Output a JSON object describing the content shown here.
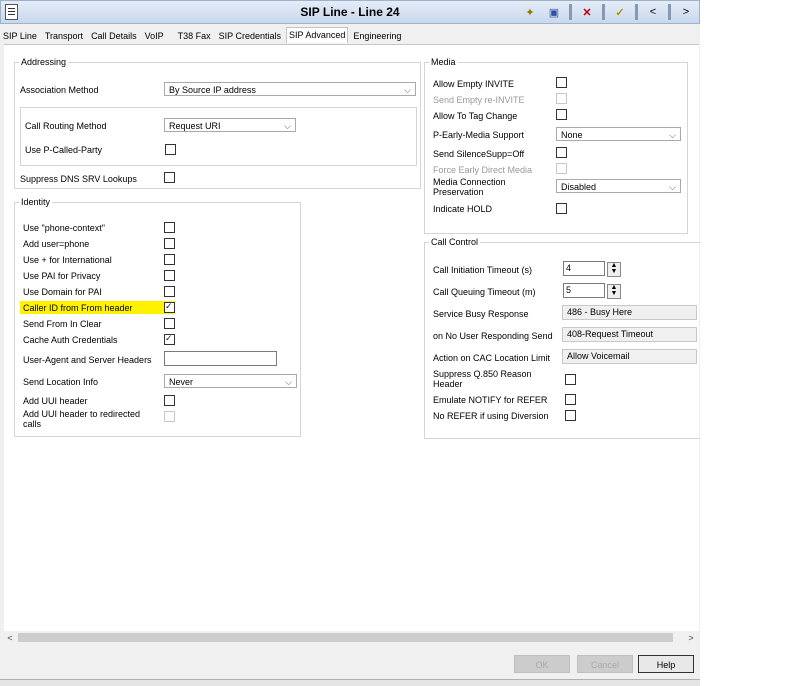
{
  "window": {
    "title": "SIP Line - Line 24",
    "toolbar_icons": [
      "new-icon",
      "save-icon",
      "delete-icon",
      "validate-icon",
      "previous-icon",
      "next-icon"
    ]
  },
  "tabs": [
    {
      "label": "SIP Line",
      "active": false
    },
    {
      "label": "Transport",
      "active": false
    },
    {
      "label": "Call Details",
      "active": false
    },
    {
      "label": "VoIP",
      "active": false
    },
    {
      "label": "T38 Fax",
      "active": false
    },
    {
      "label": "SIP Credentials",
      "active": false
    },
    {
      "label": "SIP Advanced",
      "active": true
    },
    {
      "label": "Engineering",
      "active": false
    }
  ],
  "addressing": {
    "legend": "Addressing",
    "association_method": {
      "label": "Association Method",
      "value": "By Source IP address"
    },
    "call_routing_method": {
      "label": "Call Routing Method",
      "value": "Request URI"
    },
    "use_p_called_party": {
      "label": "Use P-Called-Party",
      "checked": false
    },
    "suppress_dns_srv": {
      "label": "Suppress DNS SRV Lookups",
      "checked": false
    }
  },
  "identity": {
    "legend": "Identity",
    "items": [
      {
        "label": "Use \"phone-context\"",
        "checked": false
      },
      {
        "label": "Add user=phone",
        "checked": false
      },
      {
        "label": "Use + for International",
        "checked": false
      },
      {
        "label": "Use PAI for Privacy",
        "checked": false
      },
      {
        "label": "Use Domain for PAI",
        "checked": false
      },
      {
        "label": "Caller ID from From header",
        "checked": true,
        "highlight": true
      },
      {
        "label": "Send From In Clear",
        "checked": false
      },
      {
        "label": "Cache Auth Credentials",
        "checked": true
      }
    ],
    "user_agent": {
      "label": "User-Agent and Server Headers",
      "value": ""
    },
    "send_location_info": {
      "label": "Send Location Info",
      "value": "Never"
    },
    "add_uui_header": {
      "label": "Add UUI header",
      "checked": false
    },
    "add_uui_redirected": {
      "label": "Add UUI header to redirected calls",
      "checked": false,
      "disabled": true
    }
  },
  "media": {
    "legend": "Media",
    "allow_empty_invite": {
      "label": "Allow Empty INVITE",
      "checked": false
    },
    "send_empty_reinvite": {
      "label": "Send Empty re-INVITE",
      "checked": false,
      "disabled": true
    },
    "allow_to_tag_change": {
      "label": "Allow To Tag Change",
      "checked": false
    },
    "p_early_media": {
      "label": "P-Early-Media Support",
      "value": "None"
    },
    "send_silence_supp": {
      "label": "Send SilenceSupp=Off",
      "checked": false
    },
    "force_early_direct": {
      "label": "Force Early Direct Media",
      "checked": false,
      "disabled": true
    },
    "media_conn_preservation": {
      "label": "Media Connection Preservation",
      "value": "Disabled"
    },
    "indicate_hold": {
      "label": "Indicate HOLD",
      "checked": false
    }
  },
  "call_control": {
    "legend": "Call Control",
    "call_initiation_timeout": {
      "label": "Call Initiation Timeout (s)",
      "value": "4"
    },
    "call_queuing_timeout": {
      "label": "Call Queuing Timeout (m)",
      "value": "5"
    },
    "service_busy_response": {
      "label": "Service Busy Response",
      "value": "486 - Busy Here"
    },
    "no_user_responding": {
      "label": "on No User Responding Send",
      "value": "408-Request Timeout"
    },
    "cac_location_limit": {
      "label": "Action on CAC Location Limit",
      "value": "Allow Voicemail"
    },
    "suppress_q850": {
      "label": "Suppress Q.850 Reason Header",
      "checked": false
    },
    "emulate_notify": {
      "label": "Emulate NOTIFY for REFER",
      "checked": false
    },
    "no_refer_diversion": {
      "label": "No REFER if using Diversion",
      "checked": false
    }
  },
  "buttons": {
    "ok": "OK",
    "cancel": "Cancel",
    "help": "Help"
  }
}
